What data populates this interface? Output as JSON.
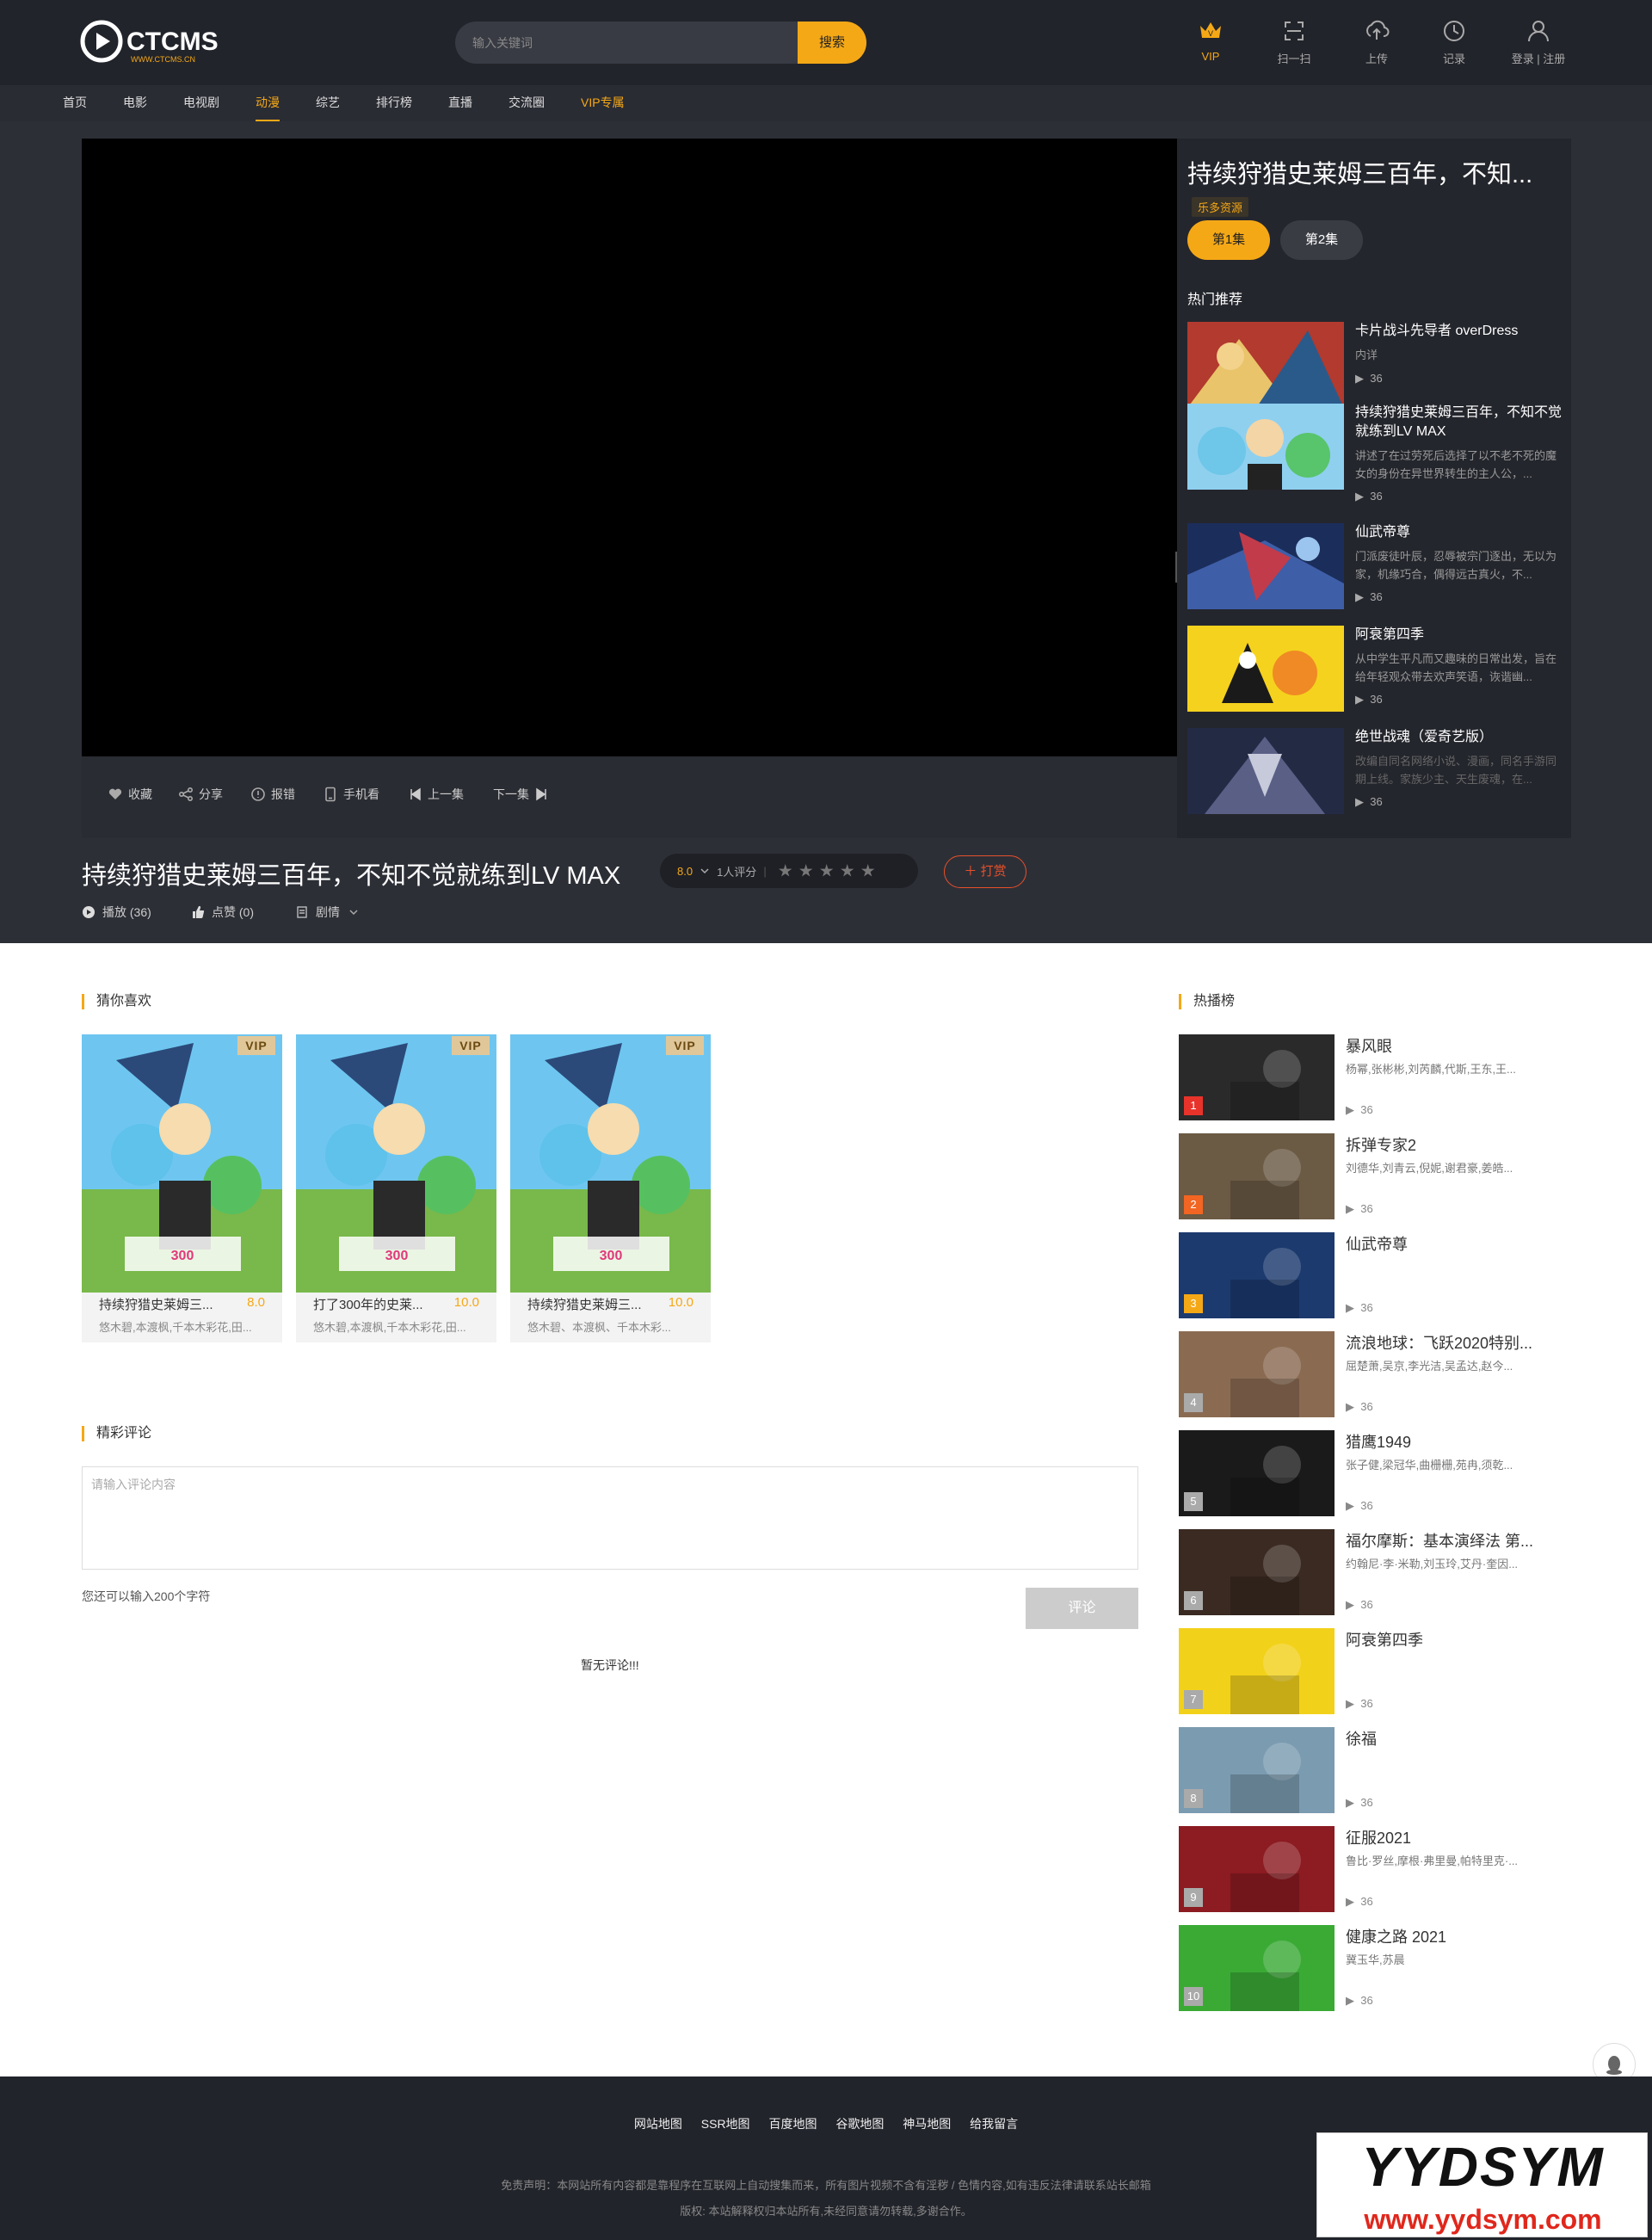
{
  "header": {
    "logo_text": "CTCMS",
    "logo_sub": "WWW.CTCMS.CN",
    "search_placeholder": "输入关键词",
    "search_button": "搜索",
    "icons": [
      {
        "label": "VIP",
        "icon": "crown-icon"
      },
      {
        "label": "扫一扫",
        "icon": "scan-icon"
      },
      {
        "label": "上传",
        "icon": "upload-icon"
      },
      {
        "label": "记录",
        "icon": "clock-icon"
      },
      {
        "label": "登录 | 注册",
        "icon": "user-icon"
      }
    ]
  },
  "nav": [
    "首页",
    "电影",
    "电视剧",
    "动漫",
    "综艺",
    "排行榜",
    "直播",
    "交流圈",
    "VIP专属"
  ],
  "nav_active": "动漫",
  "player": {
    "tools": [
      "收藏",
      "分享",
      "报错",
      "手机看",
      "上一集",
      "下一集"
    ]
  },
  "sidebar": {
    "title": "持续狩猎史莱姆三百年，不知...",
    "source": "乐多资源",
    "episodes": [
      "第1集",
      "第2集"
    ],
    "hot_title": "热门推荐",
    "items": [
      {
        "title": "卡片战斗先导者 overDress",
        "desc": "内详",
        "plays": "36"
      },
      {
        "title": "持续狩猎史莱姆三百年，不知不觉就练到LV MAX",
        "desc": "讲述了在过劳死后选择了以不老不死的魔女的身份在异世界转生的主人公，...",
        "plays": "36"
      },
      {
        "title": "仙武帝尊",
        "desc": "门派废徒叶辰，忍辱被宗门逐出，无以为家，机缘巧合，偶得远古真火，不...",
        "plays": "36"
      },
      {
        "title": "阿衰第四季",
        "desc": "从中学生平凡而又趣味的日常出发，旨在给年轻观众带去欢声笑语，诙谐幽...",
        "plays": "36"
      },
      {
        "title": "绝世战魂（爱奇艺版）",
        "desc": "改编自同名网络小说、漫画，同名手游同期上线。家族少主、天生废魂，在...",
        "plays": "36"
      }
    ]
  },
  "info": {
    "title": "持续狩猎史莱姆三百年，不知不觉就练到LV MAX",
    "score": "8.0",
    "rating_count": "1人评分",
    "reward": "打赏",
    "play_label": "播放 (36)",
    "like_label": "点赞 (0)",
    "plot_label": "剧情"
  },
  "guess": {
    "title": "猜你喜欢",
    "cards": [
      {
        "title": "持续狩猎史莱姆三...",
        "score": "8.0",
        "cast": "悠木碧,本渡枫,千本木彩花,田...",
        "badge": "VIP"
      },
      {
        "title": "打了300年的史莱...",
        "score": "10.0",
        "cast": "悠木碧,本渡枫,千本木彩花,田...",
        "badge": "VIP"
      },
      {
        "title": "持续狩猎史莱姆三...",
        "score": "10.0",
        "cast": "悠木碧、本渡枫、千本木彩...",
        "badge": "VIP"
      }
    ]
  },
  "comments": {
    "title": "精彩评论",
    "placeholder": "请输入评论内容",
    "hint": "您还可以输入200个字符",
    "button": "评论",
    "empty": "暂无评论!!!"
  },
  "hotlist": {
    "title": "热播榜",
    "items": [
      {
        "rank": "1",
        "title": "暴风眼",
        "cast": "杨幂,张彬彬,刘芮麟,代斯,王东,王...",
        "plays": "36",
        "color": "#2a2a2a"
      },
      {
        "rank": "2",
        "title": "拆弹专家2",
        "cast": "刘德华,刘青云,倪妮,谢君豪,姜皓...",
        "plays": "36",
        "color": "#6b5a44"
      },
      {
        "rank": "3",
        "title": "仙武帝尊",
        "cast": "",
        "plays": "36",
        "color": "#1c3a6e"
      },
      {
        "rank": "4",
        "title": "流浪地球：飞跃2020特别...",
        "cast": "屈楚萧,吴京,李光洁,吴孟达,赵今...",
        "plays": "36",
        "color": "#8a6b52"
      },
      {
        "rank": "5",
        "title": "猎鹰1949",
        "cast": "张子健,梁冠华,曲栅栅,苑冉,须乾...",
        "plays": "36",
        "color": "#1a1a1a"
      },
      {
        "rank": "6",
        "title": "福尔摩斯：基本演绎法 第...",
        "cast": "约翰尼·李·米勒,刘玉玲,艾丹·奎因...",
        "plays": "36",
        "color": "#3a2a22"
      },
      {
        "rank": "7",
        "title": "阿衰第四季",
        "cast": "",
        "plays": "36",
        "color": "#f2d11b"
      },
      {
        "rank": "8",
        "title": "徐福",
        "cast": "",
        "plays": "36",
        "color": "#7b9bb0"
      },
      {
        "rank": "9",
        "title": "征服2021",
        "cast": "鲁比·罗丝,摩根·弗里曼,帕特里克·...",
        "plays": "36",
        "color": "#8c1b22"
      },
      {
        "rank": "10",
        "title": "健康之路 2021",
        "cast": "冀玉华,苏晨",
        "plays": "36",
        "color": "#3aaa35"
      }
    ]
  },
  "footer": {
    "links": [
      "网站地图",
      "SSR地图",
      "百度地图",
      "谷歌地图",
      "神马地图",
      "给我留言"
    ],
    "disclaimer": "免责声明：本网站所有内容都是靠程序在互联网上自动搜集而来，所有图片视频不含有淫秽 / 色情内容,如有违反法律请联系站长邮箱",
    "copyright": "版权: 本站解释权归本站所有,未经同意请勿转载,多谢合作。"
  },
  "watermark": {
    "line1": "YYDSYM",
    "line2": "www.yydsym.com"
  },
  "colors": {
    "accent": "#f5a816",
    "header_bg": "#22242b",
    "stage_bg": "#2d2f37",
    "danger": "#e8502a"
  }
}
